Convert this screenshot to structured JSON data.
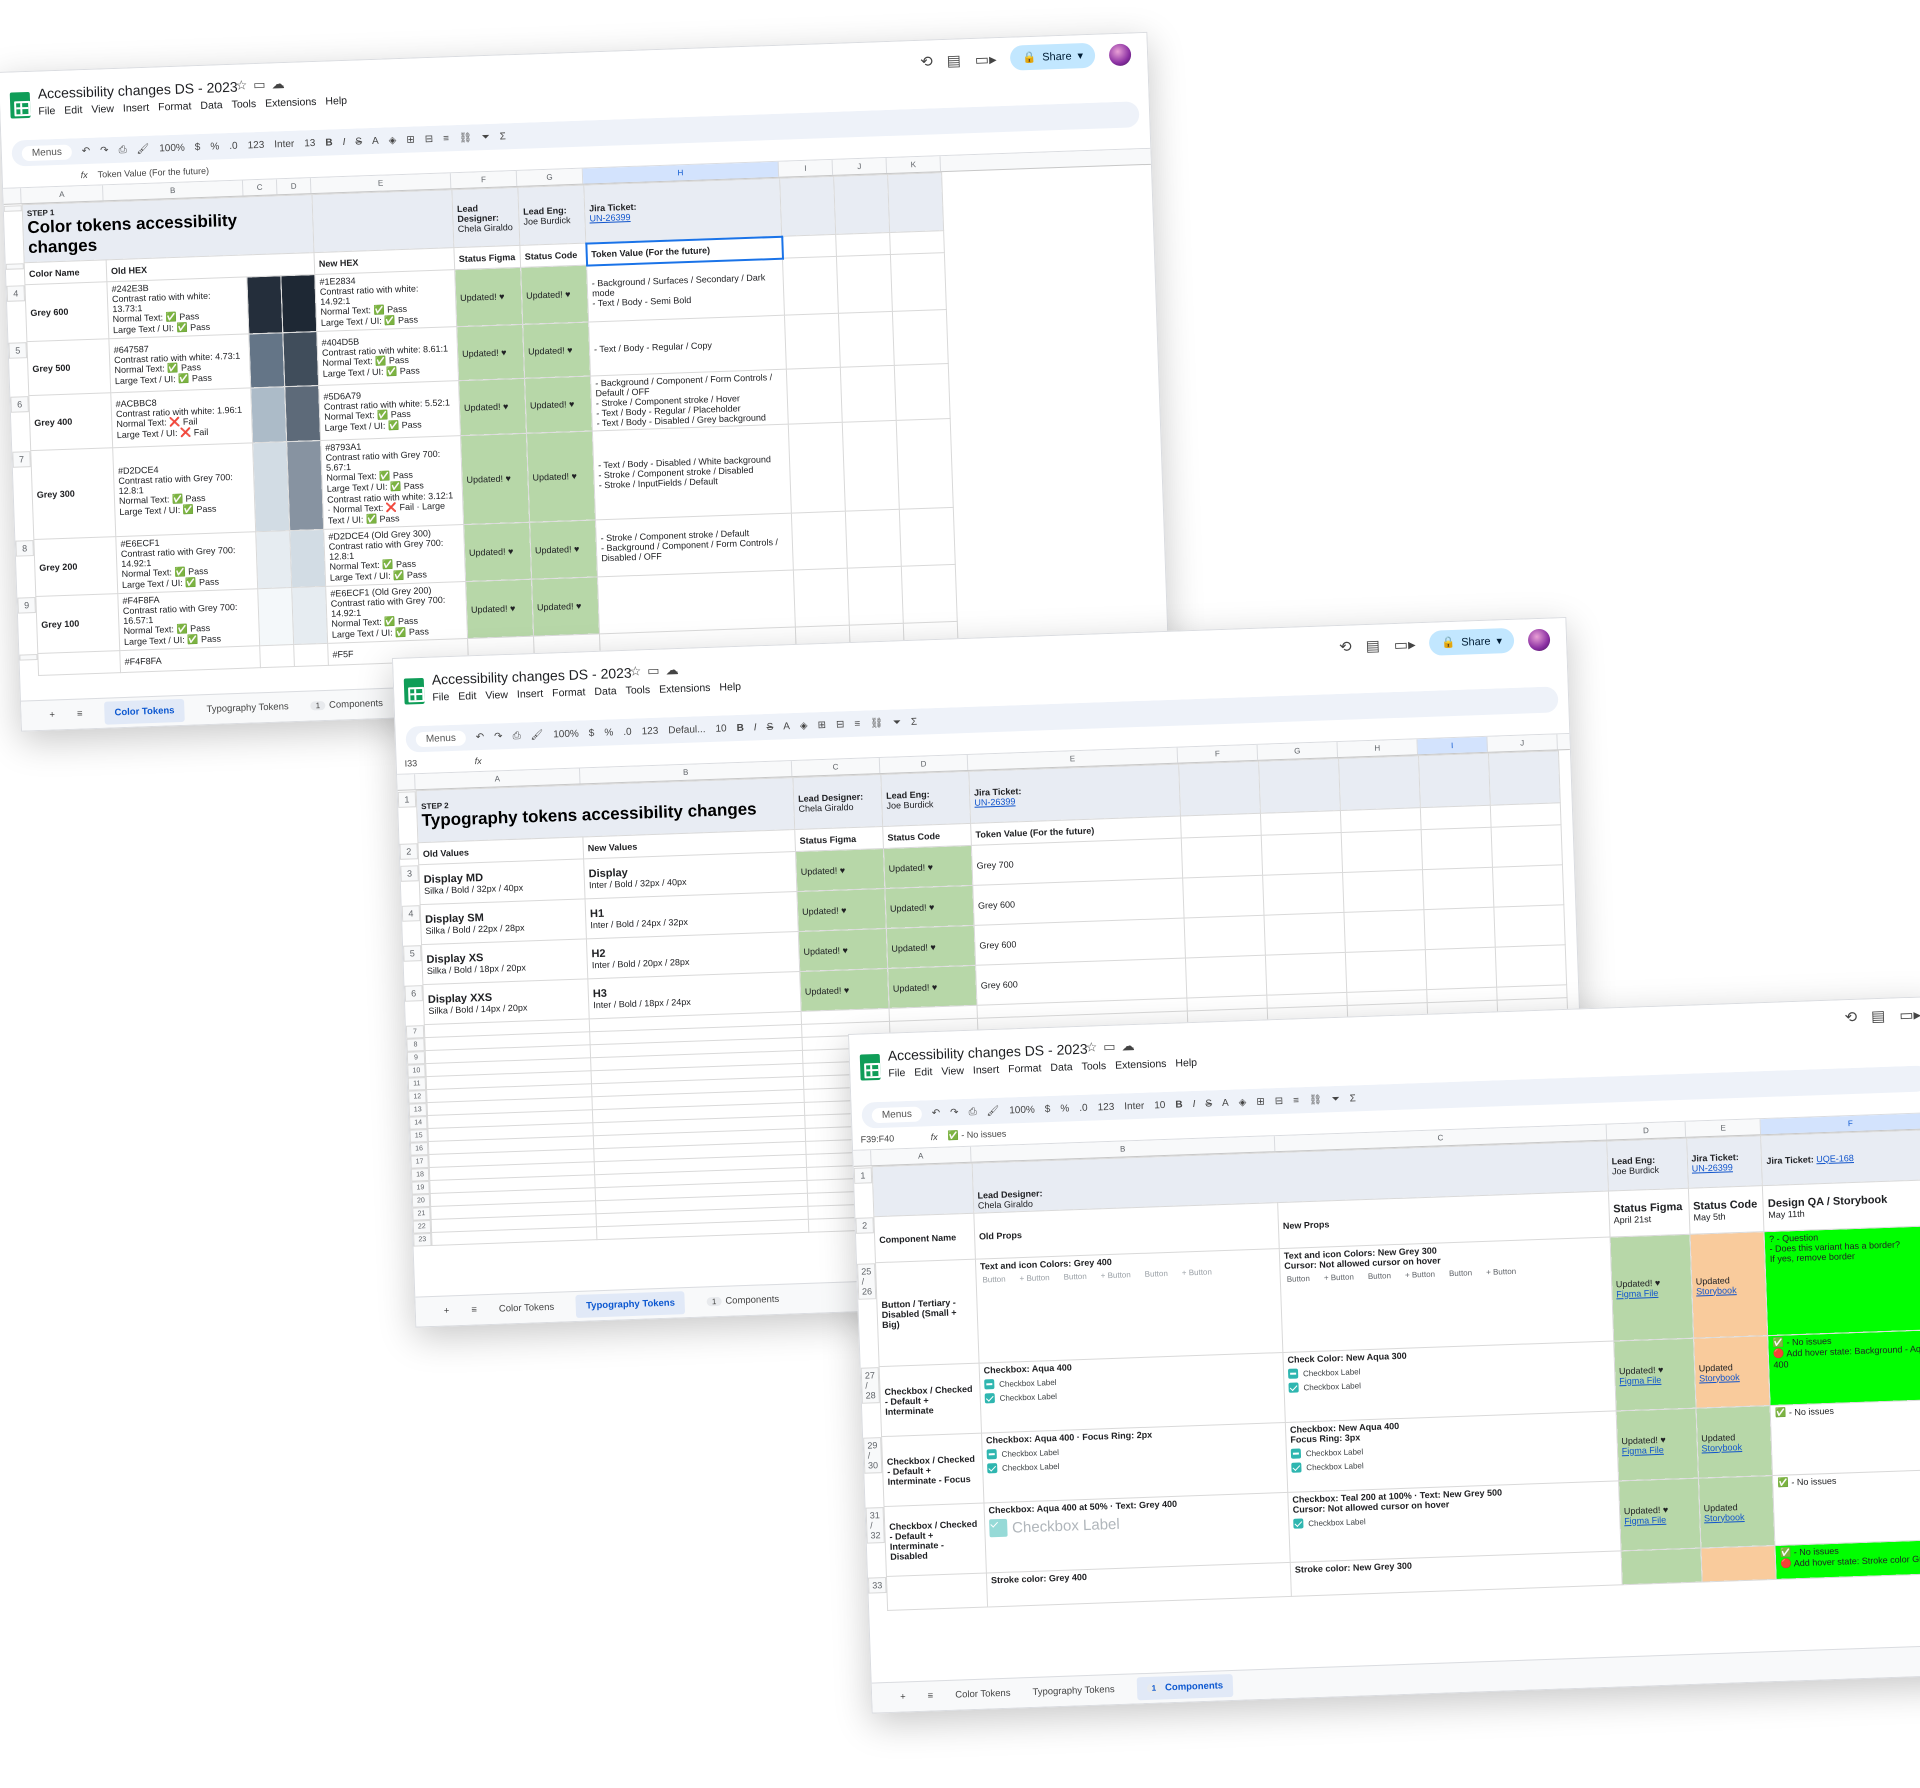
{
  "app": {
    "doc_title": "Accessibility changes DS - 2023",
    "menu": [
      "File",
      "Edit",
      "View",
      "Insert",
      "Format",
      "Data",
      "Tools",
      "Extensions",
      "Help"
    ],
    "share_label": "Share",
    "menus_search": "Menus",
    "zoom": "100%",
    "font_inter": "Inter",
    "font_default": "Defaul...",
    "font_size_13": "13",
    "font_size_10": "10",
    "formula_icon": "fx",
    "icons": [
      "star-icon",
      "folder-icon",
      "cloud-icon",
      "history-icon",
      "comment-icon",
      "video-icon",
      "undo-icon",
      "redo-icon",
      "print-icon",
      "paint-format-icon",
      "bold-icon",
      "italic-icon",
      "strikethrough-icon",
      "text-color-icon",
      "fill-color-icon",
      "borders-icon",
      "merge-icon",
      "align-icon",
      "link-icon",
      "comment-add-icon",
      "chart-icon",
      "filter-icon",
      "functions-icon",
      "collapse-icon"
    ]
  },
  "tabs": {
    "color": "Color Tokens",
    "typography": "Typography Tokens",
    "components": "Components",
    "components_badge": "1"
  },
  "window1": {
    "formula_value": "Token Value (For the future)",
    "columns": [
      "A",
      "B",
      "C",
      "D",
      "E",
      "F",
      "G",
      "H",
      "I",
      "J",
      "K"
    ],
    "step": "STEP 1",
    "title": "Color tokens accessibility changes",
    "lead_designer_label": "Lead Designer:",
    "lead_designer": "Chela Giraldo",
    "lead_eng_label": "Lead Eng:",
    "lead_eng": "Joe Burdick",
    "jira_label": "Jira Ticket:",
    "jira": "UN-26399",
    "headers": {
      "color_name": "Color Name",
      "old_hex": "Old HEX",
      "new_hex": "New HEX",
      "status_figma": "Status Figma",
      "status_code": "Status Code",
      "token_value": "Token Value (For the future)"
    },
    "rows": [
      {
        "num": "4",
        "name": "Grey 600",
        "old_hex": "#242E3B",
        "old_ratio": "Contrast ratio with white: 13.73:1",
        "old_normal": "Normal Text: ✅ Pass",
        "old_large": "Large Text / UI: ✅ Pass",
        "old_color": "#242e3b",
        "new_color": "#1e2834",
        "new_hex": "#1E2834",
        "new_ratio": "Contrast ratio with white: 14.92:1",
        "new_normal": "Normal Text: ✅ Pass",
        "new_large": "Large Text / UI: ✅ Pass",
        "new_extra": "",
        "figma": "Updated! ♥",
        "code": "Updated! ♥",
        "token": "- Background / Surfaces / Secondary / Dark mode\n- Text / Body - Semi Bold"
      },
      {
        "num": "5",
        "name": "Grey 500",
        "old_hex": "#647587",
        "old_ratio": "Contrast ratio with white: 4.73:1",
        "old_normal": "Normal Text: ✅ Pass",
        "old_large": "Large Text / UI: ✅ Pass",
        "old_color": "#647587",
        "new_color": "#404d5b",
        "new_hex": "#404D5B",
        "new_ratio": "Contrast ratio with white: 8.61:1",
        "new_normal": "Normal Text: ✅ Pass",
        "new_large": "Large Text / UI: ✅ Pass",
        "new_extra": "",
        "figma": "Updated! ♥",
        "code": "Updated! ♥",
        "token": "- Text / Body - Regular / Copy"
      },
      {
        "num": "6",
        "name": "Grey 400",
        "old_hex": "#ACBBC8",
        "old_ratio": "Contrast ratio with white: 1.96:1",
        "old_normal": "Normal Text: ❌ Fail",
        "old_large": "Large Text / UI: ❌ Fail",
        "old_color": "#acbbc8",
        "new_color": "#5d6a79",
        "new_hex": "#5D6A79",
        "new_ratio": "Contrast ratio with white: 5.52:1",
        "new_normal": "Normal Text: ✅ Pass",
        "new_large": "Large Text / UI: ✅ Pass",
        "new_extra": "",
        "figma": "Updated! ♥",
        "code": "Updated! ♥",
        "token": "- Background / Component / Form Controls / Default / OFF\n- Stroke / Component stroke / Hover\n- Text / Body - Regular / Placeholder\n- Text / Body - Disabled / Grey background"
      },
      {
        "num": "7",
        "name": "Grey 300",
        "old_hex": "#D2DCE4",
        "old_ratio": "Contrast ratio with Grey 700: 12.8:1",
        "old_normal": "Normal Text: ✅ Pass",
        "old_large": "Large Text / UI: ✅ Pass",
        "old_color": "#d2dce4",
        "new_color": "#8793a1",
        "new_hex": "#8793A1",
        "new_ratio": "Contrast ratio with Grey 700: 5.67:1",
        "new_normal": "Normal Text: ✅ Pass",
        "new_large": "Large Text / UI: ✅ Pass",
        "new_extra": "Contrast ratio with white: 3.12:1 · Normal Text: ❌ Fail · Large Text / UI: ✅ Pass",
        "figma": "Updated! ♥",
        "code": "Updated! ♥",
        "token": "- Text / Body - Disabled / White background\n- Stroke / Component stroke / Disabled\n- Stroke / InputFields / Default"
      },
      {
        "num": "8",
        "name": "Grey 200",
        "old_hex": "#E6ECF1",
        "old_ratio": "Contrast ratio with Grey 700: 14.92:1",
        "old_normal": "Normal Text: ✅ Pass",
        "old_large": "Large Text / UI: ✅ Pass",
        "old_color": "#e6ecf1",
        "new_color": "#d2dce4",
        "new_hex": "#D2DCE4 (Old Grey 300)",
        "new_ratio": "Contrast ratio with Grey 700: 12.8:1",
        "new_normal": "Normal Text: ✅ Pass",
        "new_large": "Large Text / UI: ✅ Pass",
        "new_extra": "",
        "figma": "Updated! ♥",
        "code": "Updated! ♥",
        "token": "- Stroke / Component stroke / Default\n- Background / Component / Form Controls / Disabled / OFF"
      },
      {
        "num": "9",
        "name": "Grey 100",
        "old_hex": "#F4F8FA",
        "old_ratio": "Contrast ratio with Grey 700: 16.57:1",
        "old_normal": "Normal Text: ✅ Pass",
        "old_large": "Large Text / UI: ✅ Pass",
        "old_color": "#f4f8fa",
        "new_color": "#e6ecf1",
        "new_hex": "#E6ECF1 (Old Grey 200)",
        "new_ratio": "Contrast ratio with Grey 700: 14.92:1",
        "new_normal": "Normal Text: ✅ Pass",
        "new_large": "Large Text / UI: ✅ Pass",
        "new_extra": "",
        "figma": "Updated! ♥",
        "code": "Updated! ♥",
        "token": ""
      }
    ],
    "partial_old": "#F4F8FA",
    "partial_new": "#F5F"
  },
  "window2": {
    "cell_ref": "I33",
    "columns": [
      "A",
      "B",
      "C",
      "D",
      "E",
      "F",
      "G",
      "H",
      "I",
      "J"
    ],
    "step": "STEP 2",
    "title": "Typography tokens accessibility changes",
    "lead_designer_label": "Lead Designer:",
    "lead_designer": "Chela Giraldo",
    "lead_eng_label": "Lead Eng:",
    "lead_eng": "Joe Burdick",
    "jira_label": "Jira Ticket:",
    "jira": "UN-26399",
    "headers": {
      "old_values": "Old Values",
      "new_values": "New Values",
      "status_figma": "Status Figma",
      "status_code": "Status Code",
      "token_value": "Token Value (For the future)"
    },
    "rows": [
      {
        "num": "3",
        "old_name": "Display MD",
        "old_spec": "Silka / Bold / 32px / 40px",
        "new_name": "Display",
        "new_spec": "Inter / Bold / 32px / 40px",
        "figma": "Updated! ♥",
        "code": "Updated! ♥",
        "token": "Grey 700"
      },
      {
        "num": "4",
        "old_name": "Display SM",
        "old_spec": "Silka / Bold / 22px / 28px",
        "new_name": "H1",
        "new_spec": "Inter / Bold / 24px / 32px",
        "figma": "Updated! ♥",
        "code": "Updated! ♥",
        "token": "Grey 600"
      },
      {
        "num": "5",
        "old_name": "Display XS",
        "old_spec": "Silka / Bold / 18px / 20px",
        "new_name": "H2",
        "new_spec": "Inter / Bold / 20px / 28px",
        "figma": "Updated! ♥",
        "code": "Updated! ♥",
        "token": "Grey 600"
      },
      {
        "num": "6",
        "old_name": "Display XXS",
        "old_spec": "Silka / Bold / 14px / 20px",
        "new_name": "H3",
        "new_spec": "Inter / Bold / 18px / 24px",
        "figma": "Updated! ♥",
        "code": "Updated! ♥",
        "token": "Grey 600"
      }
    ],
    "empty_rows": [
      "7",
      "8",
      "9",
      "10",
      "11",
      "12",
      "13",
      "14",
      "15",
      "16",
      "17",
      "18",
      "19",
      "20",
      "21",
      "22",
      "23"
    ]
  },
  "window3": {
    "cell_ref": "F39:F40",
    "formula_value": "✅ - No issues",
    "columns": [
      "A",
      "B",
      "C",
      "D",
      "E",
      "F"
    ],
    "lead_designer_label": "Lead Designer:",
    "lead_designer": "Chela Giraldo",
    "lead_eng_label": "Lead Eng:",
    "lead_eng": "Joe Burdick",
    "jira_label": "Jira Ticket:",
    "jira": "UN-26399",
    "jira2_label": "Jira Ticket:",
    "jira2": "UQE-168",
    "headers": {
      "component_name": "Component Name",
      "old_props": "Old Props",
      "new_props": "New Props",
      "status_figma": "Status Figma",
      "status_figma_date": "April 21st",
      "status_code": "Status Code",
      "status_code_date": "May 5th",
      "design_qa": "Design QA / Storybook",
      "design_qa_date": "May 11th"
    },
    "button_label": "Button",
    "checkbox_label": "Checkbox Label",
    "figma_link": "Figma File",
    "storybook_link": "Storybook",
    "updated_heart": "Updated! ♥",
    "updated": "Updated",
    "rows": [
      {
        "nums": "25 / 26",
        "name": "Button / Tertiary - Disabled (Small + Big)",
        "old_props": "Text and icon Colors: Grey 400",
        "new_props_1": "Text and icon Colors: New Grey 300",
        "new_props_2": "Cursor: Not allowed cursor on hover",
        "qa": "? - Question\n\n- Does this variant has a border?\n\nIf yes, remove border",
        "qa_class": "lime",
        "code_class": "peach"
      },
      {
        "nums": "27 / 28",
        "name": "Checkbox / Checked - Default + Interminate",
        "old_props": "Checkbox: Aqua 400",
        "new_props_1": "Check Color: New Aqua 300",
        "new_props_2": "",
        "qa": "✅ - No issues\n🔴 Add hover state: Background - Aqua 400",
        "qa_class": "lime",
        "code_class": "peach"
      },
      {
        "nums": "29 / 30",
        "name": "Checkbox / Checked - Default + Interminate - Focus",
        "old_props": "Checkbox: Aqua 400 · Focus Ring: 2px",
        "new_props_1": "Checkbox: New Aqua 400",
        "new_props_2": "Focus Ring: 3px",
        "qa": "✅ - No issues",
        "qa_class": "",
        "code_class": "green"
      },
      {
        "nums": "31 / 32",
        "name": "Checkbox / Checked - Default + Interminate - Disabled",
        "old_props": "Checkbox: Aqua 400 at 50% · Text: Grey 400",
        "new_props_1": "Checkbox: Teal 200 at 100% · Text: New Grey 500",
        "new_props_2": "Cursor: Not allowed cursor on hover",
        "qa": "✅ - No issues",
        "qa_class": "",
        "code_class": "green"
      },
      {
        "nums": "33",
        "name": "",
        "old_props": "Stroke color: Grey 400",
        "new_props_1": "Stroke color: New Grey 300",
        "new_props_2": "",
        "qa": "✅ - No issues\n🔴 Add hover state: Stroke color Gr",
        "qa_class": "lime",
        "code_class": "peach"
      }
    ]
  }
}
